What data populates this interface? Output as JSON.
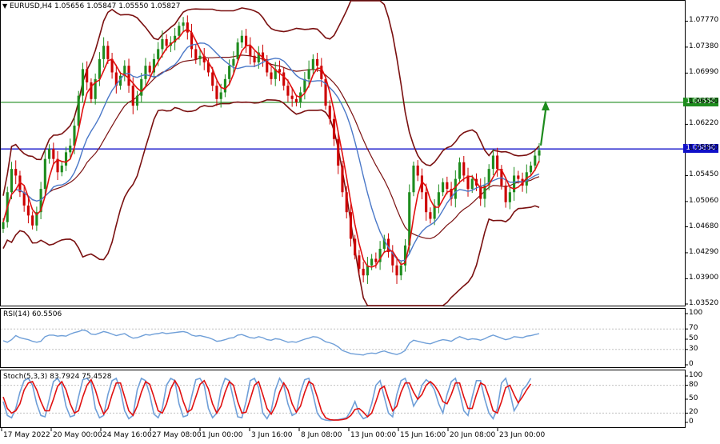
{
  "header": {
    "symbol": "EURUSD,H4",
    "ohlc": "1.05656 1.05847 1.05550 1.05827",
    "rsi_label": "RSI(14) 60.5506",
    "stoch_label": "Stoch(5,3,3) 83.7924 75.4528"
  },
  "price_axis": [
    "1.07770",
    "1.07380",
    "1.06990",
    "1.06550",
    "1.06220",
    "1.05850",
    "1.05450",
    "1.05060",
    "1.04680",
    "1.04290",
    "1.03900",
    "1.03520"
  ],
  "rsi_axis": [
    "100",
    "70",
    "50",
    "30",
    "0"
  ],
  "stoch_axis": [
    "100",
    "80",
    "50",
    "20",
    "0"
  ],
  "time_axis": [
    "17 May 2022",
    "20 May 00:00",
    "24 May 16:00",
    "27 May 08:00",
    "1 Jun 00:00",
    "3 Jun 16:00",
    "8 Jun 08:00",
    "13 Jun 00:00",
    "15 Jun 16:00",
    "20 Jun 08:00",
    "23 Jun 00:00"
  ],
  "levels": {
    "green": {
      "price": "1.06550",
      "color": "#1e8c1e"
    },
    "blue": {
      "price": "1.05850",
      "color": "#1010c8"
    }
  },
  "colors": {
    "bull": "#1e8c1e",
    "bear": "#cc0000",
    "ma_fast": "#e01010",
    "ma_slow": "#4a78c8",
    "bands": "#7a1010",
    "rsi": "#6f9fd8",
    "stoch_main": "#6f9fd8",
    "stoch_signal": "#e01010",
    "arrow": "#1e8c1e"
  },
  "icons": {
    "menu": "triangle-down-icon",
    "arrow": "up-arrow-icon"
  },
  "chart_data": {
    "type": "candlestick",
    "symbol": "EURUSD",
    "timeframe": "H4",
    "ylim": [
      1.0352,
      1.0804
    ],
    "close": [
      1.0475,
      1.052,
      1.0555,
      1.0545,
      1.052,
      1.05,
      1.0485,
      1.047,
      1.049,
      1.0525,
      1.057,
      1.0585,
      1.057,
      1.055,
      1.056,
      1.058,
      1.059,
      1.062,
      1.0665,
      1.0705,
      1.0685,
      1.066,
      1.069,
      1.072,
      1.074,
      1.072,
      1.07,
      1.068,
      1.0695,
      1.071,
      1.068,
      1.065,
      1.0665,
      1.069,
      1.071,
      1.07,
      1.072,
      1.0735,
      1.075,
      1.074,
      1.0745,
      1.0755,
      1.077,
      1.0775,
      1.076,
      1.0735,
      1.072,
      1.0725,
      1.0715,
      1.07,
      1.068,
      1.066,
      1.067,
      1.069,
      1.071,
      1.072,
      1.0745,
      1.0755,
      1.074,
      1.0725,
      1.0715,
      1.073,
      1.072,
      1.07,
      1.069,
      1.0705,
      1.07,
      1.068,
      1.0665,
      1.066,
      1.0655,
      1.067,
      1.069,
      1.0705,
      1.072,
      1.071,
      1.069,
      1.065,
      1.063,
      1.06,
      1.056,
      1.052,
      1.049,
      1.045,
      1.0425,
      1.0405,
      1.0395,
      1.041,
      1.042,
      1.0415,
      1.0435,
      1.045,
      1.043,
      1.041,
      1.0395,
      1.041,
      1.044,
      1.052,
      1.056,
      1.0545,
      1.052,
      1.049,
      1.048,
      1.05,
      1.052,
      1.0535,
      1.0525,
      1.051,
      1.054,
      1.0565,
      1.0545,
      1.0525,
      1.054,
      1.053,
      1.051,
      1.053,
      1.0555,
      1.0575,
      1.0555,
      1.053,
      1.0505,
      1.052,
      1.0545,
      1.054,
      1.053,
      1.055,
      1.056,
      1.0575,
      1.0583
    ],
    "rsi": [
      47,
      44,
      49,
      57,
      53,
      51,
      49,
      46,
      44,
      46,
      55,
      58,
      58,
      56,
      57,
      56,
      60,
      63,
      65,
      68,
      66,
      60,
      59,
      62,
      65,
      63,
      60,
      57,
      59,
      61,
      56,
      52,
      53,
      56,
      59,
      58,
      60,
      61,
      63,
      61,
      62,
      63,
      64,
      65,
      63,
      58,
      56,
      57,
      55,
      53,
      50,
      46,
      47,
      49,
      52,
      53,
      58,
      59,
      56,
      53,
      52,
      55,
      53,
      49,
      48,
      51,
      50,
      47,
      44,
      45,
      44,
      47,
      50,
      52,
      55,
      54,
      50,
      45,
      43,
      40,
      35,
      28,
      25,
      22,
      21,
      20,
      19,
      22,
      23,
      22,
      25,
      27,
      24,
      22,
      20,
      23,
      28,
      42,
      48,
      46,
      44,
      42,
      41,
      44,
      47,
      49,
      48,
      46,
      51,
      55,
      52,
      49,
      51,
      50,
      48,
      51,
      55,
      58,
      55,
      52,
      49,
      51,
      55,
      54,
      53,
      56,
      57,
      59,
      61
    ],
    "stoch_k": [
      45,
      15,
      10,
      30,
      65,
      90,
      95,
      80,
      40,
      15,
      12,
      50,
      88,
      95,
      80,
      35,
      12,
      15,
      55,
      92,
      95,
      85,
      30,
      10,
      15,
      60,
      90,
      95,
      70,
      25,
      8,
      15,
      70,
      95,
      90,
      60,
      18,
      10,
      30,
      80,
      95,
      90,
      40,
      12,
      15,
      55,
      92,
      95,
      80,
      30,
      10,
      20,
      70,
      95,
      90,
      50,
      12,
      10,
      45,
      90,
      95,
      75,
      20,
      8,
      25,
      70,
      95,
      80,
      40,
      15,
      20,
      65,
      92,
      95,
      60,
      20,
      8,
      5,
      4,
      5,
      6,
      8,
      10,
      25,
      45,
      20,
      8,
      12,
      40,
      80,
      90,
      55,
      20,
      12,
      60,
      90,
      95,
      70,
      35,
      50,
      80,
      92,
      85,
      70,
      40,
      20,
      60,
      88,
      95,
      65,
      25,
      15,
      55,
      90,
      90,
      50,
      20,
      8,
      30,
      85,
      95,
      65,
      25,
      40,
      70,
      80,
      95
    ],
    "stoch_d": [
      55,
      30,
      20,
      25,
      40,
      70,
      85,
      88,
      70,
      45,
      25,
      25,
      50,
      78,
      88,
      70,
      40,
      20,
      25,
      55,
      80,
      92,
      70,
      40,
      18,
      30,
      60,
      85,
      85,
      55,
      25,
      15,
      35,
      65,
      88,
      82,
      55,
      25,
      20,
      40,
      72,
      90,
      75,
      45,
      22,
      28,
      55,
      82,
      90,
      72,
      40,
      20,
      35,
      65,
      88,
      80,
      45,
      20,
      22,
      50,
      80,
      88,
      60,
      30,
      18,
      35,
      65,
      85,
      70,
      40,
      22,
      35,
      65,
      88,
      82,
      55,
      25,
      10,
      6,
      5,
      5,
      6,
      8,
      15,
      28,
      30,
      22,
      12,
      20,
      45,
      72,
      78,
      50,
      25,
      35,
      65,
      85,
      85,
      65,
      50,
      60,
      80,
      88,
      80,
      65,
      45,
      40,
      60,
      85,
      85,
      55,
      30,
      30,
      60,
      85,
      80,
      55,
      25,
      20,
      45,
      75,
      80,
      60,
      42,
      55,
      70,
      83
    ]
  }
}
